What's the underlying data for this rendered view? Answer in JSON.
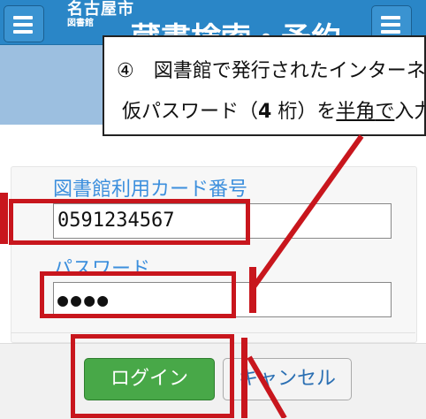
{
  "header": {
    "logo_line1": "名古屋市",
    "logo_line2": "図書館",
    "title": "蔵書検索・予約"
  },
  "callout": {
    "number": "④",
    "line1": "図書館で発行されたインターネ",
    "line2_pre": "仮パスワード（",
    "line2_bold": "4",
    "line2_mid": " 桁）を",
    "line2_underline1": "半角",
    "line2_underline2": "で",
    "line2_post": "入力"
  },
  "form": {
    "card_label": "図書館利用カード番号",
    "card_value": "0591234567",
    "password_label": "パスワード",
    "password_value": "●●●●"
  },
  "buttons": {
    "login": "ログイン",
    "cancel": "キャンセル"
  },
  "colors": {
    "header_bg": "#2a86c7",
    "label_color": "#3c8fdd",
    "login_bg": "#48a848",
    "annotation_red": "#c8161d"
  }
}
